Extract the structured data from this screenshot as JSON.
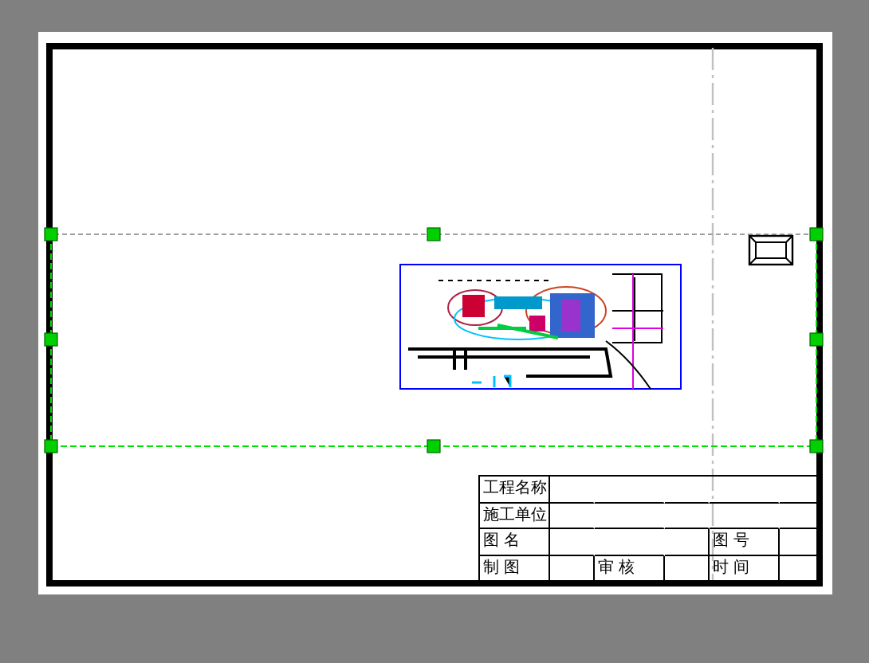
{
  "title_block": {
    "rows": [
      {
        "kind": "single",
        "cells": [
          "工程名称",
          "",
          "",
          "",
          "",
          ""
        ]
      },
      {
        "kind": "single",
        "cells": [
          "施工单位",
          "",
          "",
          "",
          "",
          ""
        ]
      },
      {
        "kind": "pair",
        "cells": [
          "图 名",
          "",
          "",
          "",
          "图 号",
          ""
        ]
      },
      {
        "kind": "triple",
        "cells": [
          "制 图",
          "",
          "审 核",
          "",
          "时 间",
          ""
        ]
      }
    ]
  }
}
